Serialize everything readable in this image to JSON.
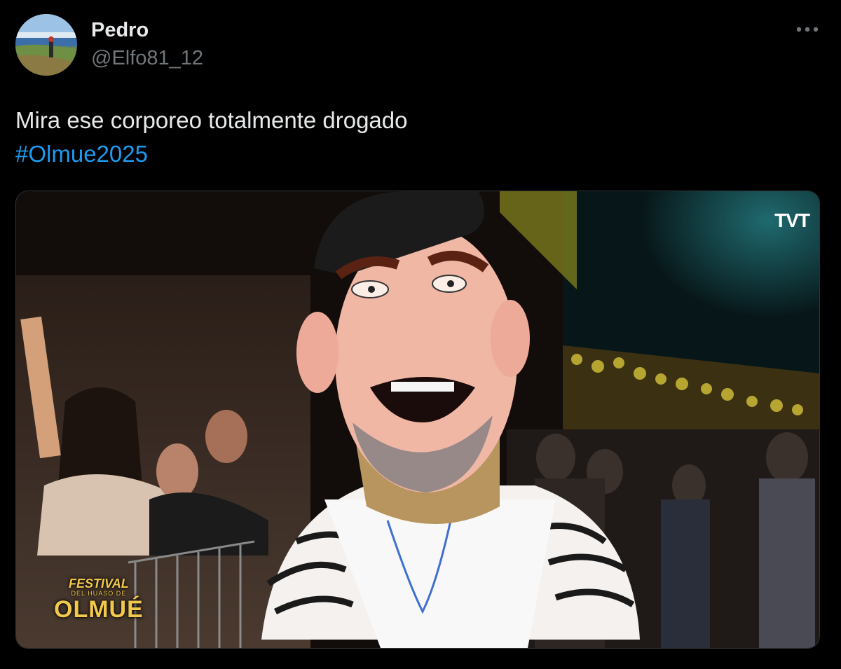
{
  "author": {
    "name": "Pedro",
    "handle": "@Elfo81_12"
  },
  "tweet": {
    "text": "Mira ese corporeo totalmente drogado",
    "hashtag": "#Olmue2025"
  },
  "media": {
    "watermark": "TVT",
    "logo": {
      "line1": "FESTIVAL",
      "line2": "DEL HUASO DE",
      "line3": "OLMUÉ"
    }
  },
  "icons": {
    "more": "more-options-icon"
  },
  "colors": {
    "background": "#000000",
    "text": "#e7e9ea",
    "secondary": "#71767b",
    "accent": "#1d9bf0"
  }
}
